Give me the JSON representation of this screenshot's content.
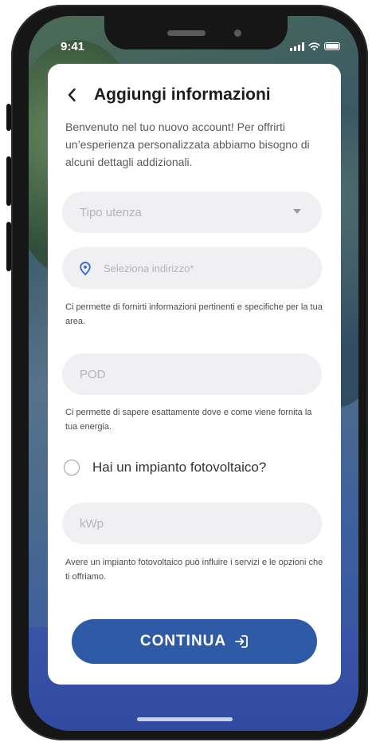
{
  "status_bar": {
    "time": "9:41"
  },
  "header": {
    "title": "Aggiungi informazioni"
  },
  "intro": "Benvenuto nel tuo nuovo account! Per offrirti un’esperienza personalizzata abbiamo bisogno di alcuni dettagli addizionali.",
  "form": {
    "user_type": {
      "placeholder": "Tipo utenza"
    },
    "address": {
      "placeholder": "Seleziona indirizzo*",
      "helper": "Ci permette di fornirti informazioni pertinenti e specifiche per la tua area."
    },
    "pod": {
      "placeholder": "POD",
      "helper": "Ci permette di sapere esattamente dove e come viene fornita la tua energia."
    },
    "photovoltaic": {
      "label": "Hai un impianto fotovoltaico?",
      "checked": false
    },
    "kwp": {
      "placeholder": "kWp",
      "helper": "Avere un impianto fotovoltaico può influire i servizi e le opzioni che ti offriamo."
    }
  },
  "continue_label": "CONTINUA",
  "colors": {
    "primary": "#2f5aa6",
    "field_bg": "#f0f0f2",
    "pin_icon": "#3a6fd8"
  },
  "icons": [
    "chevron-left-icon",
    "caret-down-icon",
    "location-pin-icon",
    "login-arrow-icon",
    "signal-icon",
    "wifi-icon",
    "battery-icon"
  ]
}
